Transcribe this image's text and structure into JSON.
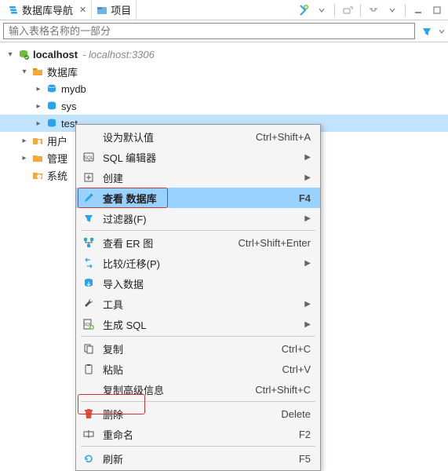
{
  "tabs": {
    "t0": {
      "label": "数据库导航"
    },
    "t1": {
      "label": "项目"
    }
  },
  "search": {
    "placeholder": "输入表格名称的一部分"
  },
  "tree": {
    "host": {
      "label": "localhost",
      "info": "- localhost:3306"
    },
    "db_folder": {
      "label": "数据库"
    },
    "db0": {
      "label": "mydb"
    },
    "db1": {
      "label": "sys"
    },
    "db2": {
      "label": "test"
    },
    "users": {
      "label": "用户"
    },
    "admin": {
      "label": "管理"
    },
    "sysinfo": {
      "label": "系统"
    }
  },
  "menu": {
    "set_default": {
      "label": "设为默认值",
      "sc": "Ctrl+Shift+A"
    },
    "sql_editor": {
      "label": "SQL 编辑器"
    },
    "create": {
      "label": "创建"
    },
    "view_db": {
      "label": "查看 数据库",
      "sc": "F4"
    },
    "filter": {
      "label": "过滤器(F)"
    },
    "er": {
      "label": "查看 ER 图",
      "sc": "Ctrl+Shift+Enter"
    },
    "compare": {
      "label": "比较/迁移(P)"
    },
    "import": {
      "label": "导入数据"
    },
    "tools": {
      "label": "工具"
    },
    "gensql": {
      "label": "生成 SQL"
    },
    "copy": {
      "label": "复制",
      "sc": "Ctrl+C"
    },
    "paste": {
      "label": "粘贴",
      "sc": "Ctrl+V"
    },
    "copyadv": {
      "label": "复制高级信息",
      "sc": "Ctrl+Shift+C"
    },
    "delete": {
      "label": "删除",
      "sc": "Delete"
    },
    "rename": {
      "label": "重命名",
      "sc": "F2"
    },
    "refresh": {
      "label": "刷新",
      "sc": "F5"
    }
  }
}
